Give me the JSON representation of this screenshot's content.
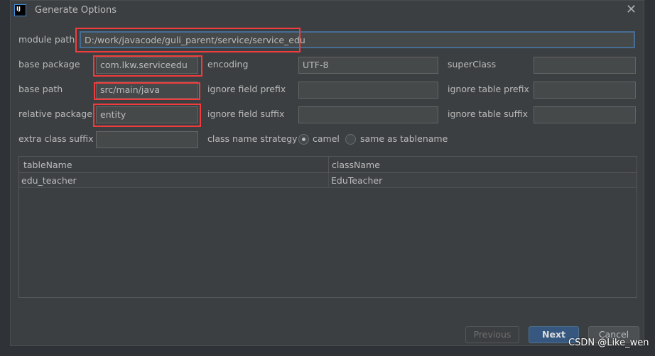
{
  "title": "Generate Options",
  "form": {
    "module_path": {
      "label": "module path",
      "value": "D:/work/javacode/guli_parent/service/service_edu"
    },
    "base_package": {
      "label": "base package",
      "value": "com.lkw.serviceedu"
    },
    "base_path": {
      "label": "base path",
      "value": "src/main/java"
    },
    "relative_package": {
      "label": "relative package",
      "value": "entity"
    },
    "extra_class_suffix": {
      "label": "extra class suffix",
      "value": ""
    },
    "encoding": {
      "label": "encoding",
      "value": "UTF-8"
    },
    "ignore_field_prefix": {
      "label": "ignore field prefix",
      "value": ""
    },
    "ignore_field_suffix": {
      "label": "ignore field suffix",
      "value": ""
    },
    "super_class": {
      "label": "superClass",
      "value": ""
    },
    "ignore_table_prefix": {
      "label": "ignore table prefix",
      "value": ""
    },
    "ignore_table_suffix": {
      "label": "ignore table suffix",
      "value": ""
    },
    "class_name_strategy": {
      "label": "class name strategy",
      "options": [
        "camel",
        "same as tablename"
      ],
      "selected": "camel"
    }
  },
  "table": {
    "columns": [
      "tableName",
      "className"
    ],
    "rows": [
      [
        "edu_teacher",
        "EduTeacher"
      ]
    ]
  },
  "buttons": {
    "previous": "Previous",
    "next": "Next",
    "cancel": "Cancel"
  },
  "watermark": "CSDN @Like_wen",
  "colors": {
    "highlight": "#f03c3c",
    "primary": "#365880"
  }
}
